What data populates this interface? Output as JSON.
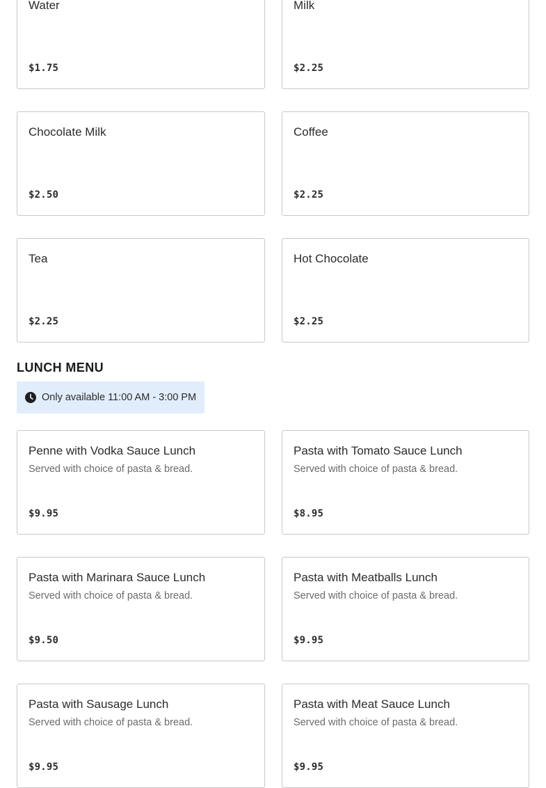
{
  "drinks": [
    {
      "name": "Water",
      "price": "$1.75"
    },
    {
      "name": "Milk",
      "price": "$2.25"
    },
    {
      "name": "Chocolate Milk",
      "price": "$2.50"
    },
    {
      "name": "Coffee",
      "price": "$2.25"
    },
    {
      "name": "Tea",
      "price": "$2.25"
    },
    {
      "name": "Hot Chocolate",
      "price": "$2.25"
    }
  ],
  "lunch": {
    "title": "LUNCH MENU",
    "availability": "Only available 11:00 AM - 3:00 PM",
    "items": [
      {
        "name": "Penne with Vodka Sauce Lunch",
        "description": "Served with choice of pasta & bread.",
        "price": "$9.95"
      },
      {
        "name": "Pasta with Tomato Sauce Lunch",
        "description": "Served with choice of pasta & bread.",
        "price": "$8.95"
      },
      {
        "name": "Pasta with Marinara Sauce Lunch",
        "description": "Served with choice of pasta & bread.",
        "price": "$9.50"
      },
      {
        "name": "Pasta with Meatballs Lunch",
        "description": "Served with choice of pasta & bread.",
        "price": "$9.95"
      },
      {
        "name": "Pasta with Sausage Lunch",
        "description": "Served with choice of pasta & bread.",
        "price": "$9.95"
      },
      {
        "name": "Pasta with Meat Sauce Lunch",
        "description": "Served with choice of pasta & bread.",
        "price": "$9.95"
      }
    ]
  },
  "icons": {
    "availability": "clock-icon"
  },
  "colors": {
    "notice_background": "#e1edfb",
    "card_border": "#c8c8c8",
    "text": "#2b2b2b",
    "muted_text": "#6b6b6b"
  }
}
